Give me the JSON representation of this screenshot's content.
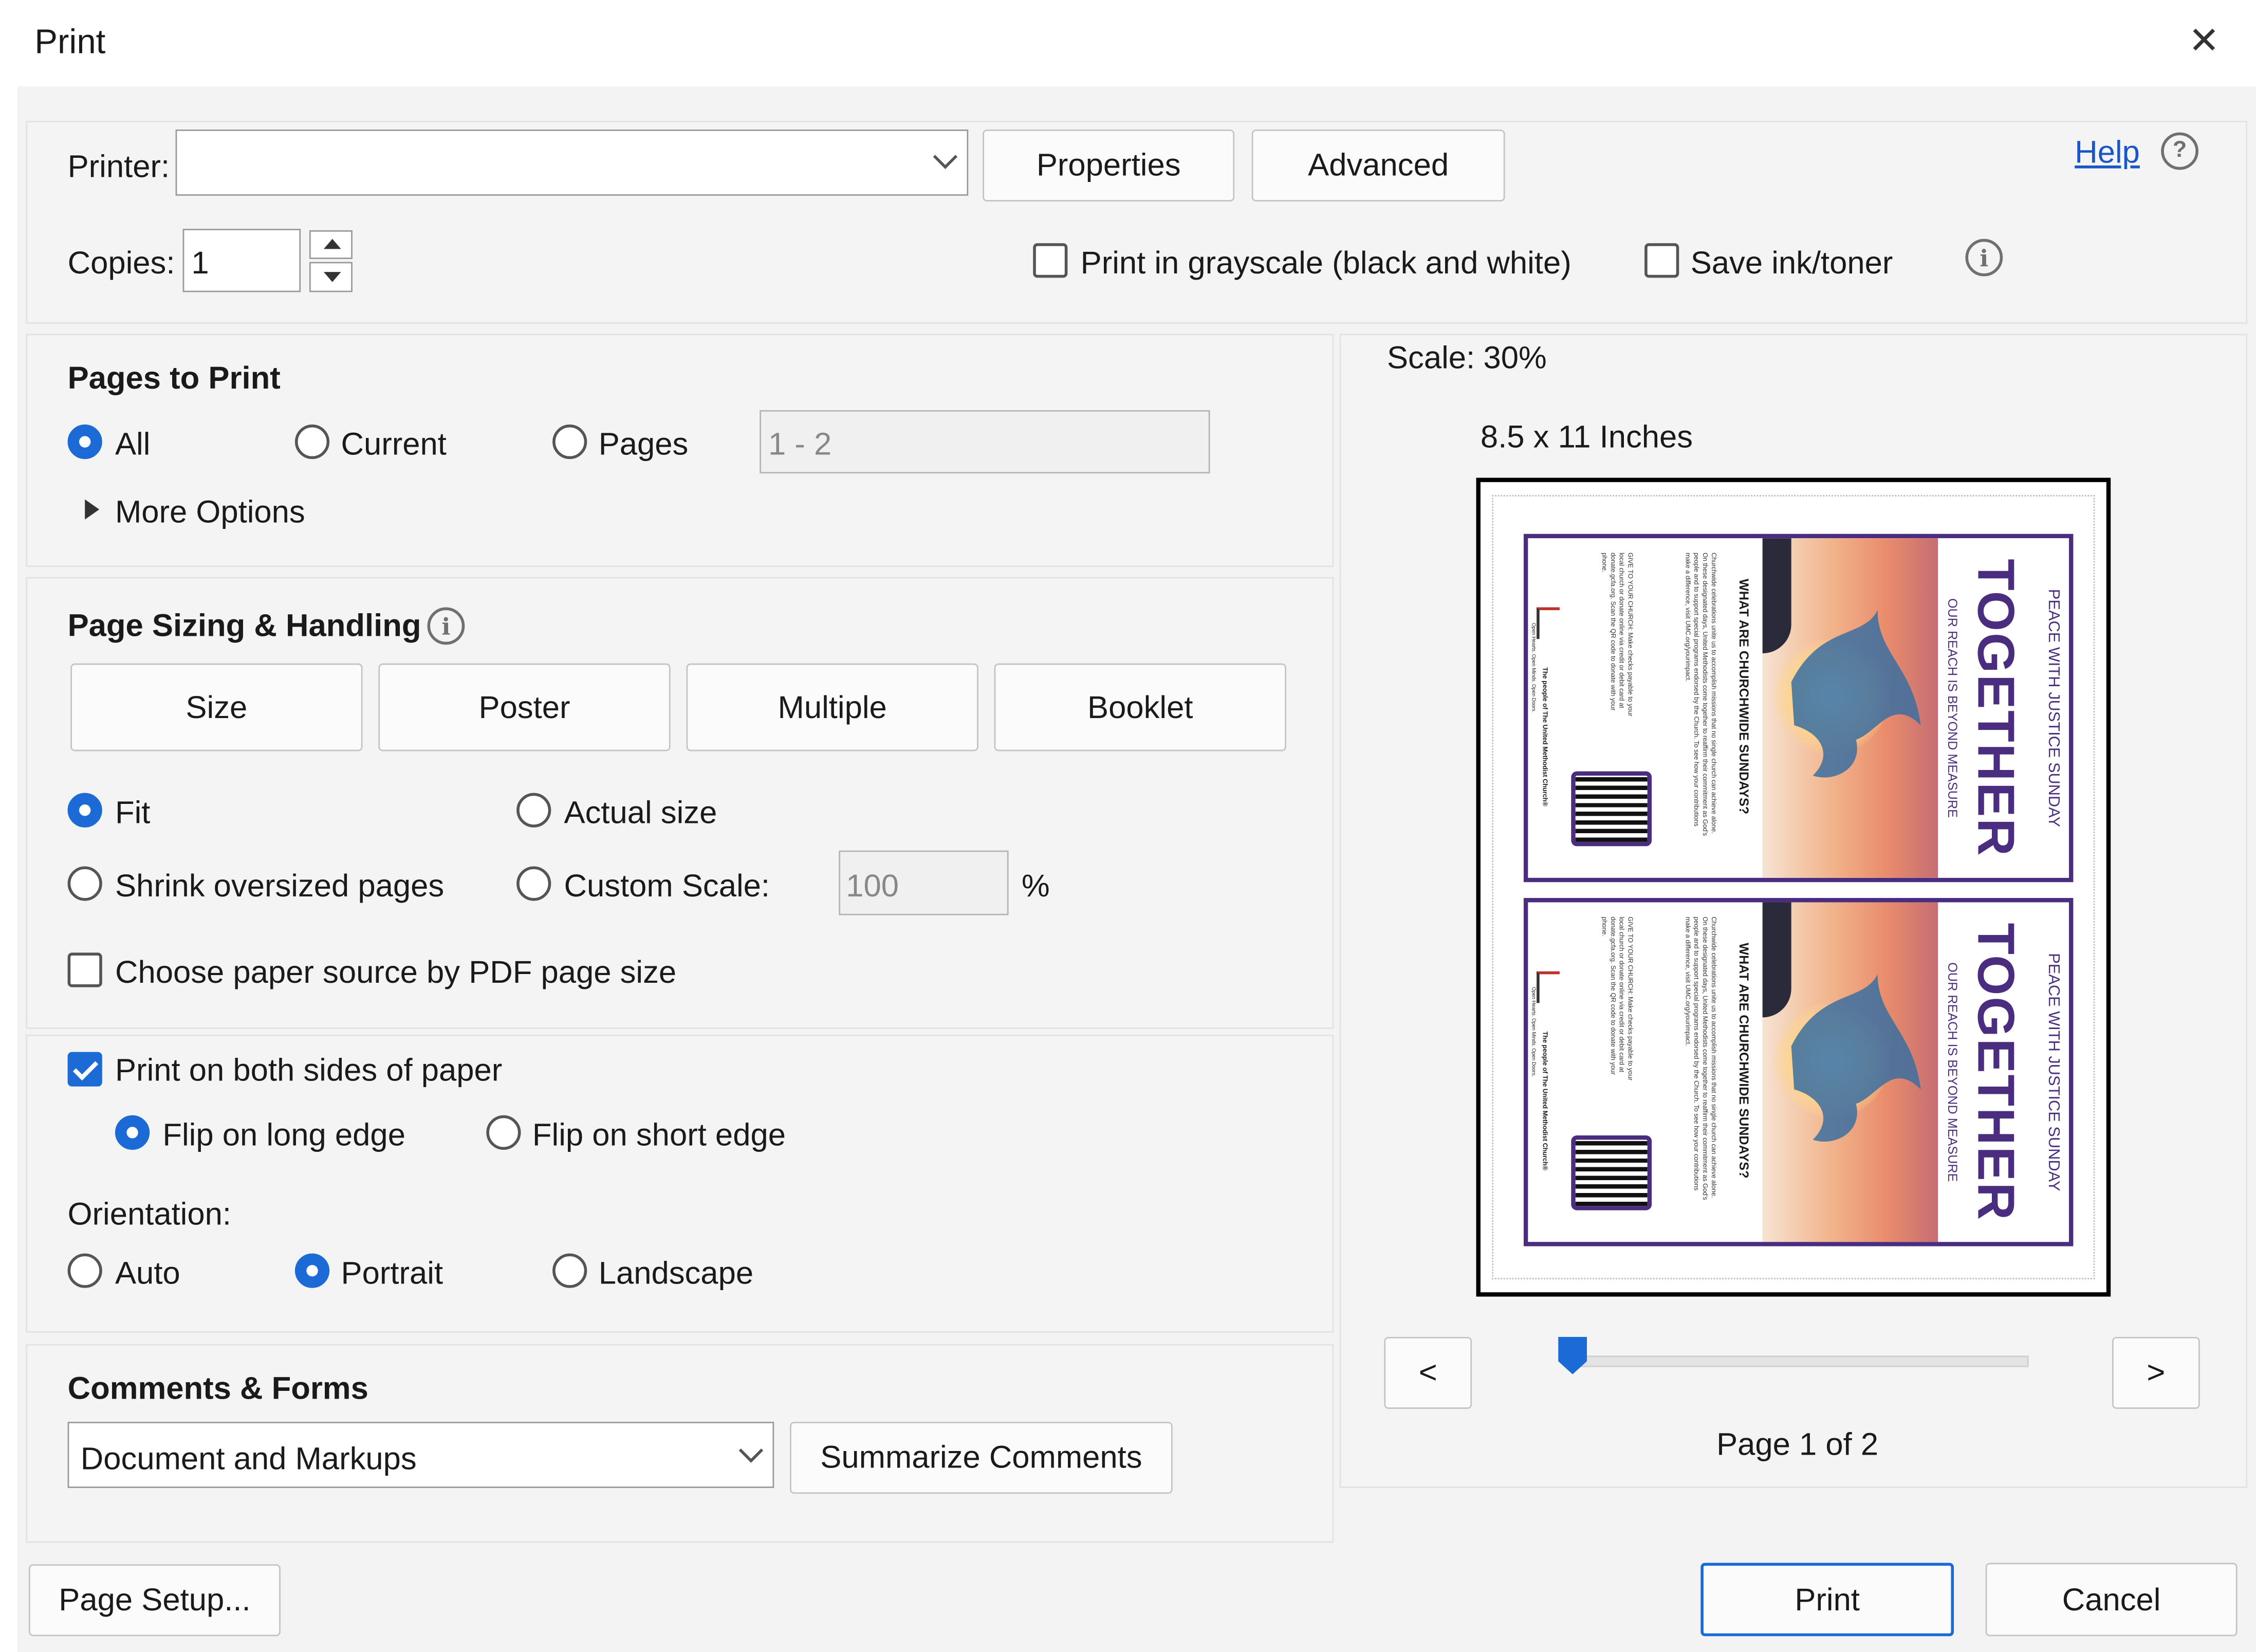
{
  "dialog": {
    "title": "Print",
    "close_symbol": "✕"
  },
  "printer": {
    "label": "Printer:",
    "value": "",
    "properties_button": "Properties",
    "advanced_button": "Advanced",
    "help_link": "Help",
    "copies_label": "Copies:",
    "copies_value": "1",
    "grayscale_label": "Print in grayscale (black and white)",
    "grayscale_checked": false,
    "save_ink_label": "Save ink/toner",
    "save_ink_checked": false
  },
  "pages_to_print": {
    "heading": "Pages to Print",
    "options": [
      "All",
      "Current",
      "Pages"
    ],
    "selected": "All",
    "pages_range": "1 - 2",
    "more_options": "More Options"
  },
  "page_sizing": {
    "heading": "Page Sizing & Handling",
    "tabs": [
      "Size",
      "Poster",
      "Multiple",
      "Booklet"
    ],
    "fit_label": "Fit",
    "actual_size_label": "Actual size",
    "shrink_label": "Shrink oversized pages",
    "custom_scale_label": "Custom Scale:",
    "custom_scale_value": "100",
    "percent": "%",
    "selected": "Fit",
    "paper_source_label": "Choose paper source by PDF page size",
    "paper_source_checked": false
  },
  "duplex": {
    "both_sides_label": "Print on both sides of paper",
    "both_sides_checked": true,
    "flip_long": "Flip on long edge",
    "flip_short": "Flip on short edge",
    "flip_selected": "long",
    "orientation_label": "Orientation:",
    "orientations": [
      "Auto",
      "Portrait",
      "Landscape"
    ],
    "orientation_selected": "Portrait"
  },
  "comments_forms": {
    "heading": "Comments & Forms",
    "dropdown_value": "Document and Markups",
    "summarize_button": "Summarize Comments"
  },
  "preview": {
    "scale_label": "Scale:",
    "scale_value": "30%",
    "paper_size": "8.5 x 11 Inches",
    "prev_button": "<",
    "next_button": ">",
    "page_indicator": "Page 1 of 2",
    "slider_position": 0,
    "poster": {
      "header": "PEACE WITH JUSTICE SUNDAY",
      "title": "TOGETHER",
      "subtitle": "OUR REACH IS BEYOND MEASURE",
      "question": "WHAT ARE CHURCHWIDE SUNDAYS?",
      "body": "Churchwide celebrations unite us to accomplish missions that no single church can achieve alone. On these designated days, United Methodists come together to reaffirm their commitment as God's people and to support special programs endorsed by the Church. To see how your contributions make a difference, visit UMC.org/yourimpact.",
      "give": "GIVE TO YOUR CHURCH: Make checks payable to your local church or donate online via credit or debit card at donate.gcfa.org. Scan the QR code to donate with your phone.",
      "tagline": "Open Hearts. Open Minds. Open Doors.",
      "org": "The people of The United Methodist Church®"
    }
  },
  "footer": {
    "page_setup_button": "Page Setup...",
    "print_button": "Print",
    "cancel_button": "Cancel"
  },
  "colors": {
    "accent": "#1b6ad6",
    "poster_purple": "#4b2d7f",
    "link": "#1b56c6"
  }
}
